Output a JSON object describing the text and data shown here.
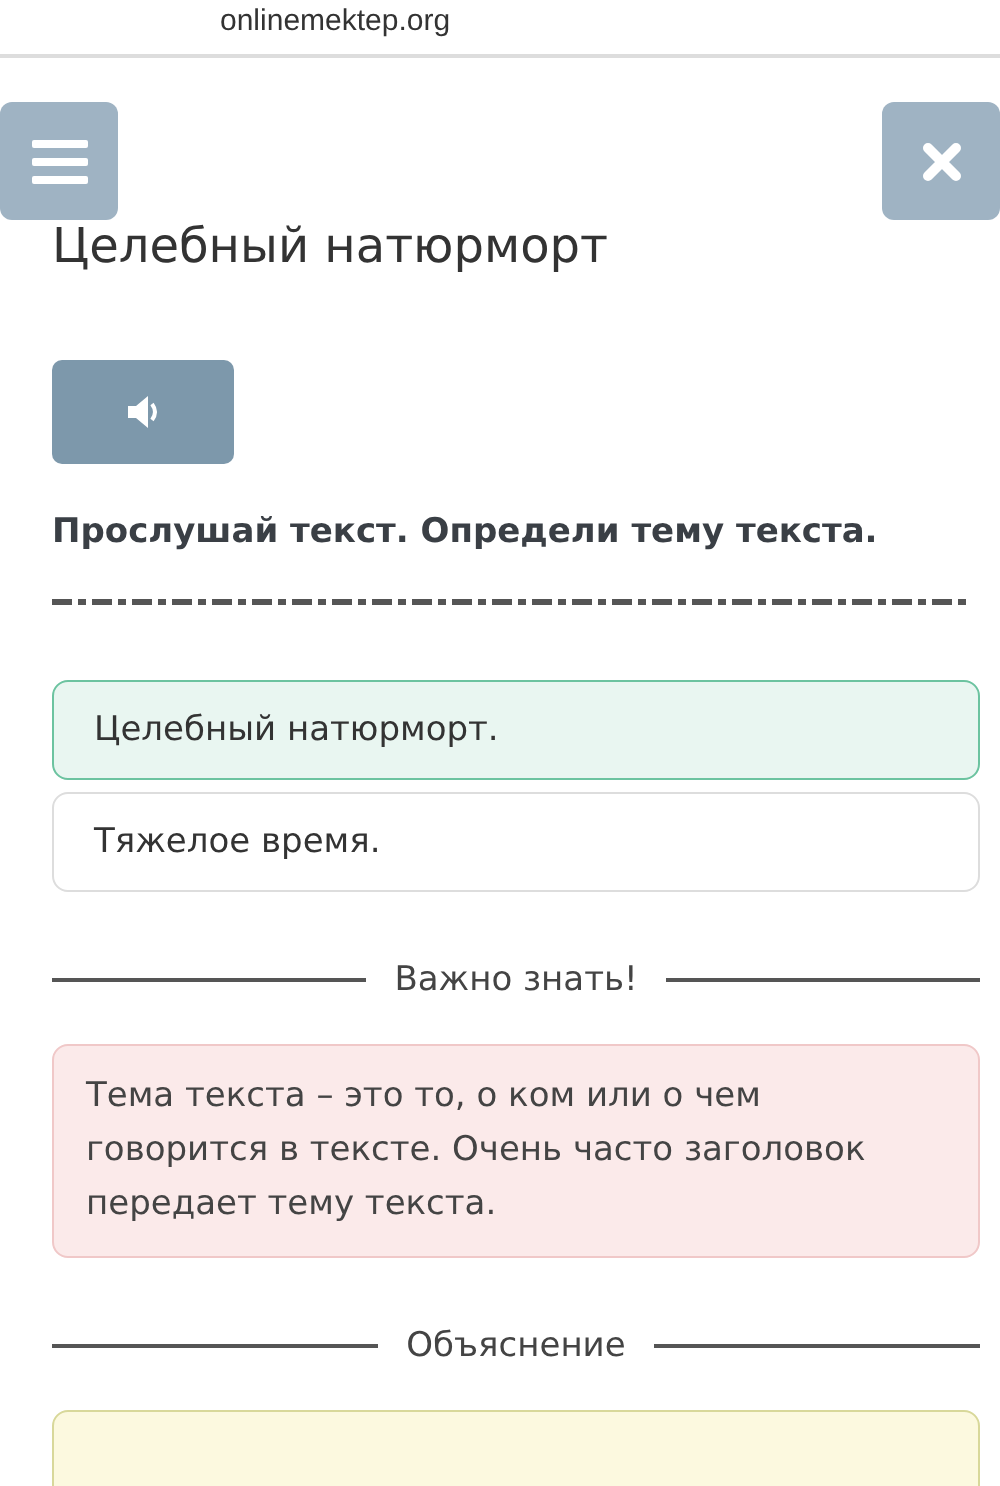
{
  "browser": {
    "url": "onlinemektep.org"
  },
  "title": "Целебный натюрморт",
  "task": "Прослушай текст. Определи тему текста.",
  "options": [
    {
      "label": "Целебный натюрморт.",
      "selected": true
    },
    {
      "label": "Тяжелое время.",
      "selected": false
    }
  ],
  "sections": [
    {
      "heading": "Важно знать!",
      "kind": "info",
      "text": "Тема текста – это то, о ком или о чем говорится в тексте. Очень часто заголовок передает тему текста."
    },
    {
      "heading": "Объяснение",
      "kind": "explanation"
    }
  ]
}
